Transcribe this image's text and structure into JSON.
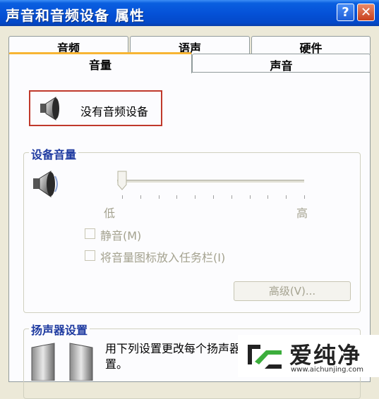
{
  "window": {
    "title": "声音和音频设备 属性",
    "help_label": "?",
    "close_label": "✕"
  },
  "tabs": {
    "back_row": [
      "音频",
      "语声",
      "硬件"
    ],
    "front_row": [
      "音量",
      "声音"
    ],
    "active": "音量"
  },
  "device": {
    "label": "没有音频设备",
    "icon": "speaker-icon"
  },
  "volume_group": {
    "title": "设备音量",
    "low_label": "低",
    "high_label": "高",
    "level": 0,
    "mute_label": "静音(M)",
    "taskbar_label": "将音量图标放入任务栏(I)",
    "advanced_label": "高级(V)..."
  },
  "speaker_group": {
    "title": "扬声器设置",
    "description": "用下列设置更改每个扬声器的",
    "description_tail": "置。"
  },
  "watermark": {
    "brand": "爱纯净",
    "url": "www.aichunjing.com"
  },
  "colors": {
    "titlebar": "#0552d8",
    "active_tab_accent": "#f7b534",
    "device_highlight": "#c0392b"
  }
}
